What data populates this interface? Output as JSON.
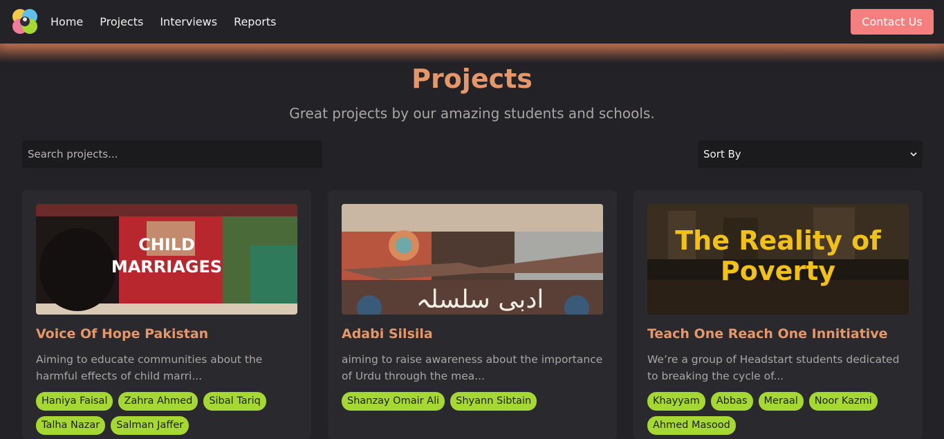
{
  "nav": {
    "logo_icon": "colorful-logo-icon",
    "links": [
      "Home",
      "Projects",
      "Interviews",
      "Reports"
    ],
    "contact_label": "Contact Us"
  },
  "header": {
    "title": "Projects",
    "subtitle": "Great projects by our amazing students and schools."
  },
  "search": {
    "placeholder": "Search projects..."
  },
  "sort": {
    "selected": "Sort By"
  },
  "cards": [
    {
      "image_caption": [
        "CHILD",
        "MARRIAGES"
      ],
      "title": "Voice Of Hope Pakistan",
      "description": "Aiming to educate communities about the harmful effects of child marri...",
      "tags": [
        "Haniya Faisal",
        "Zahra Ahmed",
        "Sibal Tariq",
        "Talha Nazar",
        "Salman Jaffer"
      ]
    },
    {
      "image_caption": [
        "ادبی سلسلہ"
      ],
      "title": "Adabi Silsila",
      "description": "aiming to raise awareness about the importance of Urdu through the mea...",
      "tags": [
        "Shanzay Omair Ali",
        "Shyann Sibtain"
      ]
    },
    {
      "image_caption": [
        "The Reality of",
        "Poverty"
      ],
      "title": "Teach One Reach One Innitiative",
      "description": "We’re a group of Headstart students dedicated to breaking the cycle of...",
      "tags": [
        "Khayyam",
        "Abbas",
        "Meraal",
        "Noor Kazmi",
        "Ahmed Masood"
      ]
    }
  ],
  "colors": {
    "background": "#232226",
    "accent": "#e6976a",
    "contact_button": "#f57f7f",
    "tag": "#a6d834",
    "nav_glow": "#de7d56"
  }
}
